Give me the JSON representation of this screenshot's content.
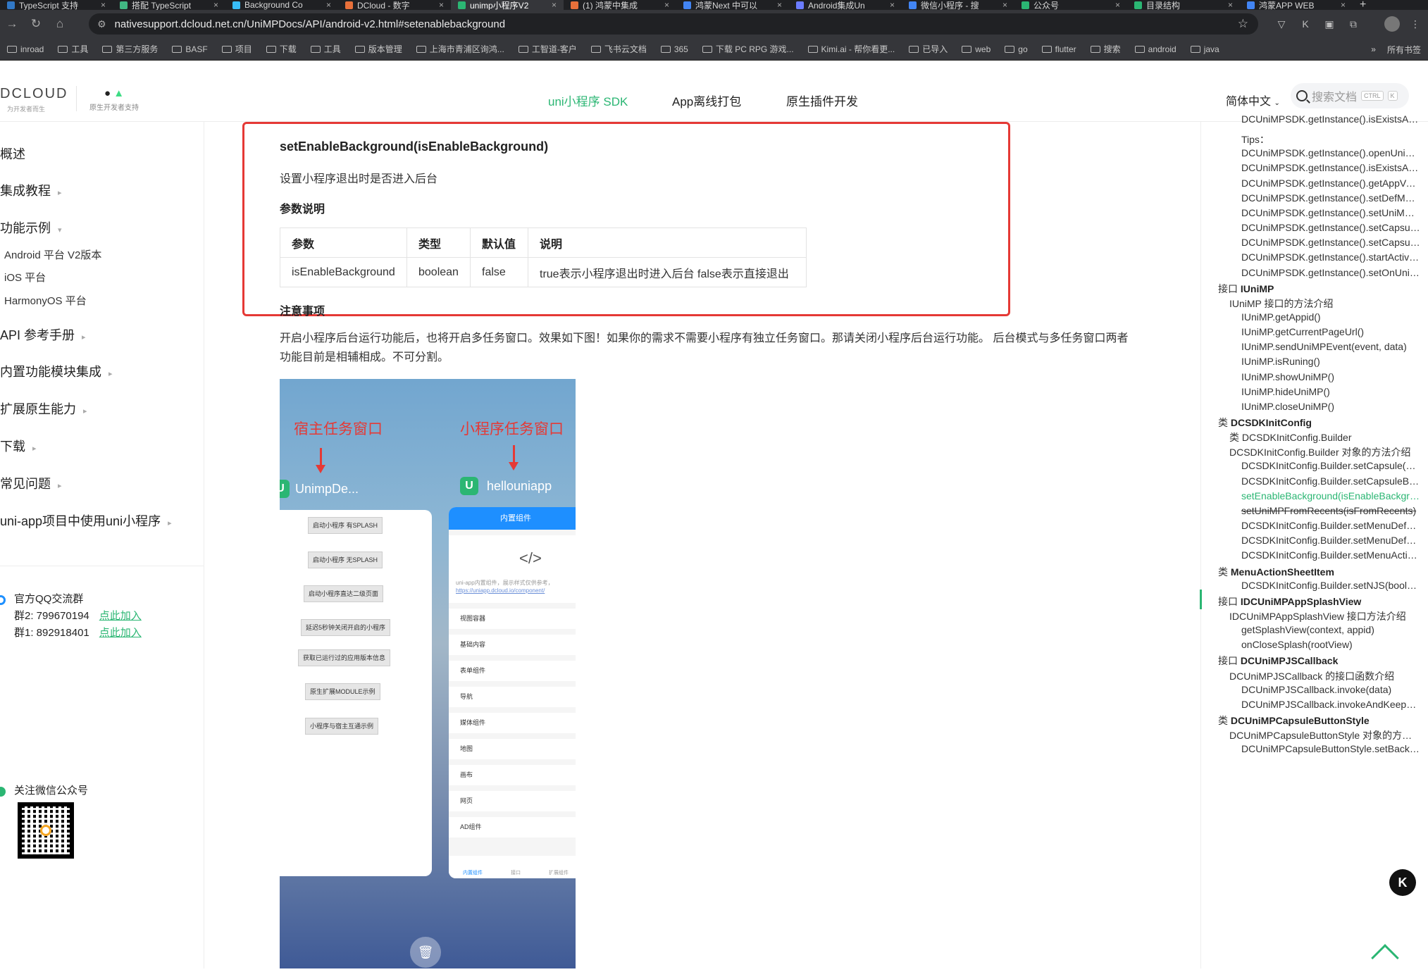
{
  "browser": {
    "tabs": [
      {
        "title": "TypeScript 支持",
        "color": "#3178c6",
        "active": false
      },
      {
        "title": "搭配 TypeScript",
        "color": "#41b883",
        "active": false
      },
      {
        "title": "Background Co",
        "color": "#38bdf8",
        "active": false
      },
      {
        "title": "DCloud - 数字",
        "color": "#e8703a",
        "active": false
      },
      {
        "title": "unimp小程序V2",
        "color": "#2bb673",
        "active": true
      },
      {
        "title": "(1) 鸿蒙中集成",
        "color": "#e8703a",
        "active": false
      },
      {
        "title": "鸿蒙Next 中可以",
        "color": "#4285f4",
        "active": false
      },
      {
        "title": "Android集成Un",
        "color": "#6b7cff",
        "active": false
      },
      {
        "title": "微信小程序 - 搜",
        "color": "#4285f4",
        "active": false
      },
      {
        "title": "公众号",
        "color": "#2bb673",
        "active": false
      },
      {
        "title": "目录结构",
        "color": "#2bb673",
        "active": false
      },
      {
        "title": "鸿蒙APP WEB",
        "color": "#4285f4",
        "active": false
      }
    ],
    "url": "nativesupport.dcloud.net.cn/UniMPDocs/API/android-v2.html#setenablebackground",
    "bookmarks": [
      "inroad",
      "工具",
      "第三方服务",
      "BASF",
      "项目",
      "下载",
      "工具",
      "版本管理",
      "上海市青浦区询鸿...",
      "工智道-客户",
      "飞书云文档",
      "365",
      "下载 PC RPG 游戏...",
      "Kimi.ai - 帮你看更...",
      "已导入",
      "web",
      "go",
      "flutter",
      "搜索",
      "android",
      "java"
    ],
    "bookmarks_more": "»",
    "bookmarks_all": "所有书签"
  },
  "header": {
    "logo": "DCLOUD",
    "logo_sub": "为开发者而生",
    "os_sub": "原生开发者支持",
    "nav": [
      "uni小程序 SDK",
      "App离线打包",
      "原生插件开发"
    ],
    "lang": "简体中文",
    "search_placeholder": "搜索文档",
    "kbd1": "CTRL",
    "kbd2": "K"
  },
  "sidebar": {
    "items": [
      "概述",
      "集成教程",
      "功能示例",
      "API 参考手册",
      "内置功能模块集成",
      "扩展原生能力",
      "下载",
      "常见问题",
      "uni-app项目中使用uni小程序"
    ],
    "sub": [
      "Android 平台 V2版本",
      "iOS 平台",
      "HarmonyOS 平台"
    ],
    "qq_title": "官方QQ交流群",
    "qq2": "群2:  799670194",
    "qq1": "群1:  892918401",
    "join": "点此加入",
    "wx_title": "关注微信公众号"
  },
  "content": {
    "title": "setEnableBackground(isEnableBackground)",
    "desc": "设置小程序退出时是否进入后台",
    "param_heading": "参数说明",
    "table": {
      "headers": [
        "参数",
        "类型",
        "默认值",
        "说明"
      ],
      "rows": [
        [
          "isEnableBackground",
          "boolean",
          "false",
          "true表示小程序退出时进入后台 false表示直接退出"
        ]
      ]
    },
    "notes_heading": "注意事项",
    "notes": "开启小程序后台运行功能后，也将开启多任务窗口。效果如下图！如果你的需求不需要小程序有独立任务窗口。那请关闭小程序后台运行功能。 后台模式与多任务窗口两者功能目前是相辅相成。不可分割。"
  },
  "screenshot": {
    "label_host": "宿主任务窗口",
    "label_mini": "小程序任务窗口",
    "app_host": "UnimpDe...",
    "app_mini": "hellouniapp",
    "host_buttons": [
      "启动小程序 有SPLASH",
      "启动小程序 无SPLASH",
      "启动小程序直达二级页面",
      "延迟5秒钟关闭开启的小程序",
      "获取已运行过的应用版本信息",
      "原生扩展MODULE示例",
      "小程序与宿主互通示例"
    ],
    "mini_header": "内置组件",
    "mini_desc": "uni-app内置组件，展示样式仅供参考，",
    "mini_url": "https://uniapp.dcloud.io/component/",
    "mini_rows": [
      "视图容器",
      "基础内容",
      "表单组件",
      "导航",
      "媒体组件",
      "地图",
      "画布",
      "网页",
      "AD组件"
    ],
    "mini_tabs": [
      "内置组件",
      "接口",
      "扩展组件"
    ]
  },
  "toc": [
    {
      "text": "DCUniMPSDK.getInstance().isExistsApp(appid)",
      "level": "l3",
      "partial": true
    },
    {
      "text": "Tips：",
      "level": "l3"
    },
    {
      "text": "DCUniMPSDK.getInstance().openUniMP(context, appid)",
      "level": "l3"
    },
    {
      "text": "DCUniMPSDK.getInstance().isExistsApp(appid)",
      "level": "l3"
    },
    {
      "text": "DCUniMPSDK.getInstance().getAppVersionInfo(appid)",
      "level": "l3"
    },
    {
      "text": "DCUniMPSDK.getInstance().setDefMenuButtonClickCallBack()",
      "level": "l3"
    },
    {
      "text": "DCUniMPSDK.getInstance().setUniMPOnCloseCallBack()",
      "level": "l3"
    },
    {
      "text": "DCUniMPSDK.getInstance().setCapsuleCloseButtonClickCallBack()",
      "level": "l3"
    },
    {
      "text": "DCUniMPSDK.getInstance().setCapsuleMenuButtonClickCallBack()",
      "level": "l3"
    },
    {
      "text": "DCUniMPSDK.getInstance().startActivityForUniMPTask()",
      "level": "l3"
    },
    {
      "text": "DCUniMPSDK.getInstance().setOnUniMPEventCallBack()",
      "level": "l3"
    },
    {
      "kind": "接口",
      "text": "IUniMP",
      "level": "l1"
    },
    {
      "text": "IUniMP 接口的方法介绍",
      "level": "l2"
    },
    {
      "text": "IUniMP.getAppid()",
      "level": "l3"
    },
    {
      "text": "IUniMP.getCurrentPageUrl()",
      "level": "l3"
    },
    {
      "text": "IUniMP.sendUniMPEvent(event, data)",
      "level": "l3"
    },
    {
      "text": "IUniMP.isRuning()",
      "level": "l3"
    },
    {
      "text": "IUniMP.showUniMP()",
      "level": "l3"
    },
    {
      "text": "IUniMP.hideUniMP()",
      "level": "l3"
    },
    {
      "text": "IUniMP.closeUniMP()",
      "level": "l3"
    },
    {
      "kind": "类",
      "text": "DCSDKInitConfig",
      "level": "l1"
    },
    {
      "text": "类 DCSDKInitConfig.Builder",
      "level": "l2"
    },
    {
      "text": "DCSDKInitConfig.Builder 对象的方法介绍",
      "level": "l2"
    },
    {
      "text": "DCSDKInitConfig.Builder.setCapsule(boolean)",
      "level": "l3"
    },
    {
      "text": "DCSDKInitConfig.Builder.setCapsuleButtonStyle()",
      "level": "l3"
    },
    {
      "text": "setEnableBackground(isEnableBackground)",
      "level": "l3",
      "active": true
    },
    {
      "text": "setUniMPFromRecents(isFromRecents)",
      "level": "l3",
      "strike": true
    },
    {
      "text": "DCSDKInitConfig.Builder.setMenuDefFontSize()",
      "level": "l3"
    },
    {
      "text": "DCSDKInitConfig.Builder.setMenuDefFontColor()",
      "level": "l3"
    },
    {
      "text": "DCSDKInitConfig.Builder.setMenuActionSheetItems()",
      "level": "l3"
    },
    {
      "kind": "类",
      "text": "MenuActionSheetItem",
      "level": "l1"
    },
    {
      "text": "DCSDKInitConfig.Builder.setNJS(boolean)",
      "level": "l3"
    },
    {
      "kind": "接口",
      "text": "IDCUniMPAppSplashView",
      "level": "l1"
    },
    {
      "text": "IDCUniMPAppSplashView 接口方法介绍",
      "level": "l2"
    },
    {
      "text": "getSplashView(context, appid)",
      "level": "l3"
    },
    {
      "text": "onCloseSplash(rootView)",
      "level": "l3"
    },
    {
      "kind": "接口",
      "text": "DCUniMPJSCallback",
      "level": "l1"
    },
    {
      "text": "DCUniMPJSCallback 的接口函数介绍",
      "level": "l2"
    },
    {
      "text": "DCUniMPJSCallback.invoke(data)",
      "level": "l3"
    },
    {
      "text": "DCUniMPJSCallback.invokeAndKeepAlive(data)",
      "level": "l3"
    },
    {
      "kind": "类",
      "text": "DCUniMPCapsuleButtonStyle",
      "level": "l1"
    },
    {
      "text": "DCUniMPCapsuleButtonStyle 对象的方法介绍",
      "level": "l2"
    },
    {
      "text": "DCUniMPCapsuleButtonStyle.setBackgroundColor()",
      "level": "l3"
    }
  ],
  "float_button": "K"
}
